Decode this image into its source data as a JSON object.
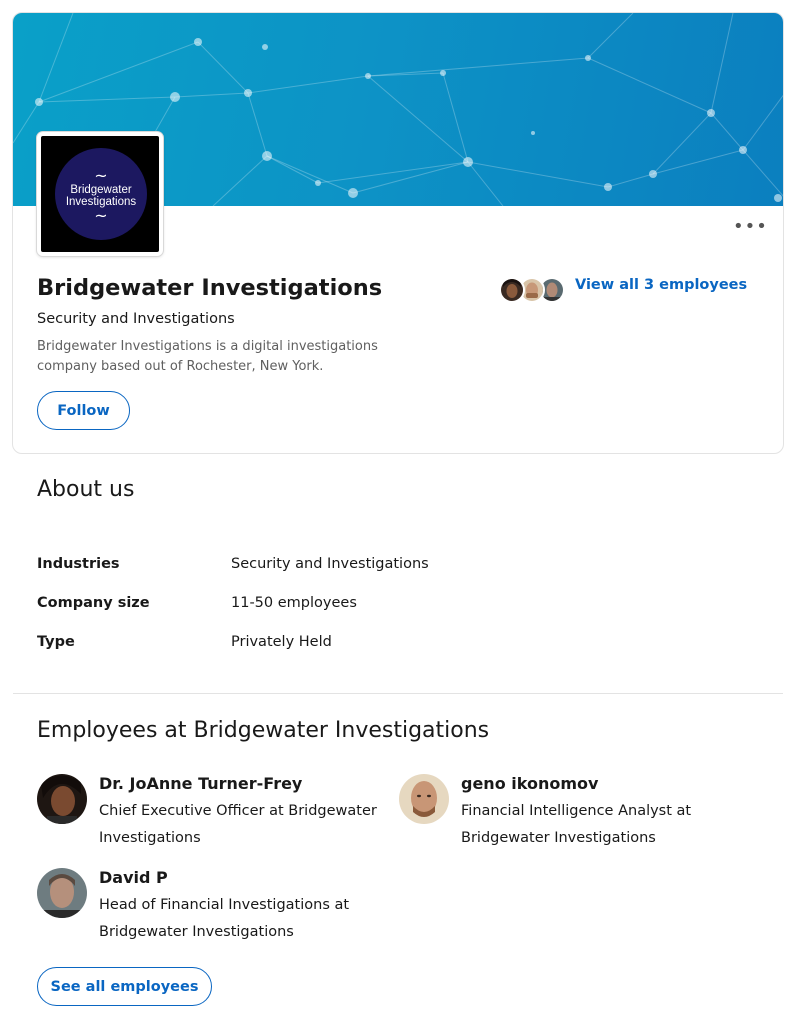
{
  "company": {
    "name": "Bridgewater Investigations",
    "industry": "Security and Investigations",
    "tagline": "Bridgewater Investigations is a digital investigations company based out of Rochester, New York.",
    "logo_text": "Bridgewater Investigations",
    "logo_squiggle": "~"
  },
  "actions": {
    "follow_label": "Follow",
    "more_label": "•••",
    "view_all_label": "View all 3 employees"
  },
  "about": {
    "title": "About us",
    "rows": [
      {
        "label": "Industries",
        "value": "Security and Investigations"
      },
      {
        "label": "Company size",
        "value": "11-50 employees"
      },
      {
        "label": "Type",
        "value": "Privately Held"
      }
    ]
  },
  "employees": {
    "title": "Employees at Bridgewater Investigations",
    "list": [
      {
        "name": "Dr. JoAnne Turner-Frey",
        "title": "Chief Executive Officer at Bridgewater Investigations"
      },
      {
        "name": "geno ikonomov",
        "title": "Financial Intelligence Analyst at Bridgewater Investigations"
      },
      {
        "name": "David P",
        "title": "Head of Financial Investigations at Bridgewater Investigations"
      }
    ],
    "see_all_label": "See all employees"
  },
  "colors": {
    "accent": "#0a66c2",
    "cover": "#0b8fc6",
    "logo_bg": "#1c1860"
  }
}
